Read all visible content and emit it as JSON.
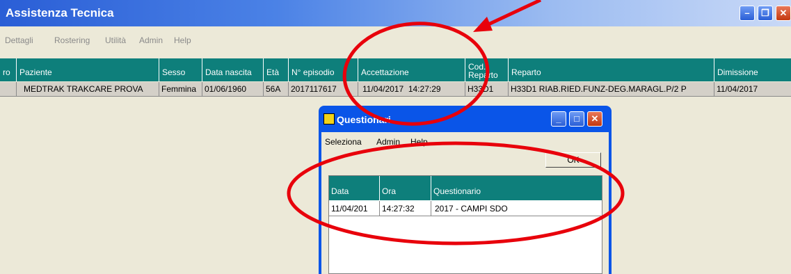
{
  "window": {
    "title": "Assistenza Tecnica"
  },
  "menu": [
    "Dettagli",
    "Rostering",
    "Utilità",
    "Admin",
    "Help"
  ],
  "grid": {
    "headers": [
      "ro",
      "Paziente",
      "Sesso",
      "Data nascita",
      "Età",
      "N° episodio",
      "Accettazione",
      "Cod. Reparto",
      "Reparto",
      "Dimissione"
    ],
    "rows": [
      [
        "",
        "MEDTRAK TRAKCARE PROVA",
        "Femmina",
        "01/06/1960",
        "56A",
        "2017117617",
        "11/04/2017  14:27:29",
        "H33D1",
        "H33D1 RIAB.RIED.FUNZ-DEG.MARAGL.P/2 P",
        "11/04/2017"
      ]
    ]
  },
  "dialog": {
    "title": "Questionari",
    "menu": [
      "Seleziona",
      "Admin",
      "Help"
    ],
    "ok_label": "OK",
    "headers": [
      "Data",
      "Ora",
      "Questionario"
    ],
    "rows": [
      [
        "11/04/201",
        "14:27:32",
        "2017 - CAMPI SDO"
      ]
    ]
  },
  "annotation_color": "#e8000b"
}
